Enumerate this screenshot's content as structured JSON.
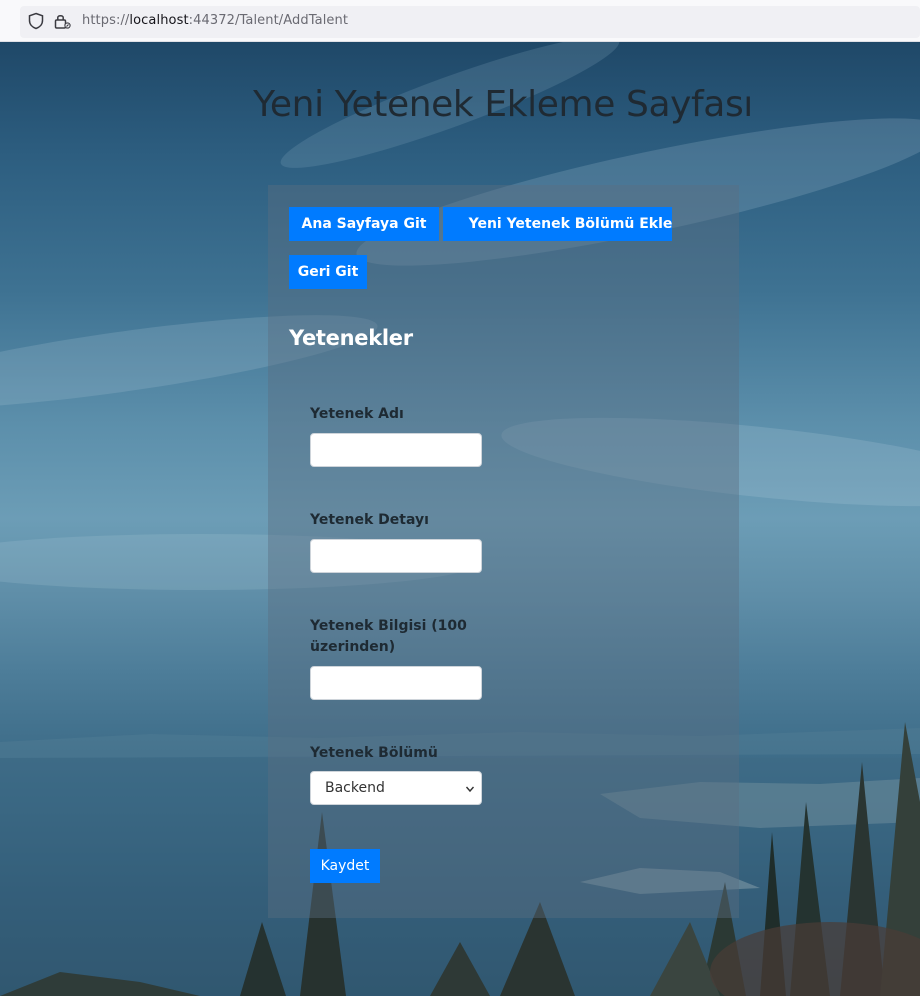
{
  "browser": {
    "url_scheme": "https://",
    "url_host": "localhost",
    "url_rest": ":44372/Talent/AddTalent"
  },
  "page": {
    "title": "Yeni Yetenek Ekleme Sayfası"
  },
  "nav": {
    "home_label": "Ana Sayfaya Git",
    "add_section_label": "Yeni Yetenek Bölümü Ekle",
    "back_label": "Geri Git"
  },
  "form": {
    "heading": "Yetenekler",
    "name_label": "Yetenek Adı",
    "name_value": "",
    "detail_label": "Yetenek Detayı",
    "detail_value": "",
    "level_label": "Yetenek Bilgisi (100 üzerinden)",
    "level_value": "",
    "section_label": "Yetenek Bölümü",
    "section_selected": "Backend",
    "save_label": "Kaydet"
  },
  "colors": {
    "primary_button": "#007bff"
  }
}
